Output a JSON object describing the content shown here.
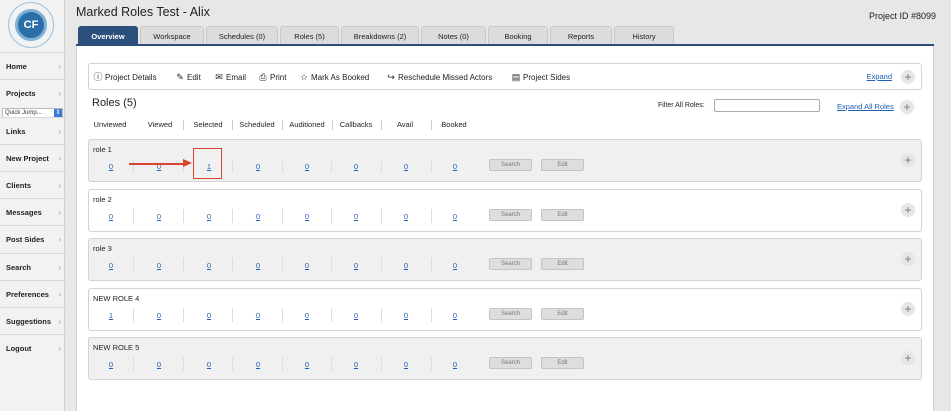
{
  "app": {
    "logo_text": "CF",
    "title": "Marked Roles Test - Alix",
    "project_id": "Project ID #8099"
  },
  "sidebar": {
    "items": [
      {
        "label": "Home"
      },
      {
        "label": "Projects"
      },
      {
        "label": "Links"
      },
      {
        "label": "New Project"
      },
      {
        "label": "Clients"
      },
      {
        "label": "Messages"
      },
      {
        "label": "Post Sides"
      },
      {
        "label": "Search"
      },
      {
        "label": "Preferences"
      },
      {
        "label": "Suggestions"
      },
      {
        "label": "Logout"
      }
    ],
    "quick_jump": "Quick Jump..."
  },
  "tabs": [
    {
      "label": "Overview",
      "active": true
    },
    {
      "label": "Workspace"
    },
    {
      "label": "Schedules (0)"
    },
    {
      "label": "Roles (5)"
    },
    {
      "label": "Breakdowns (2)"
    },
    {
      "label": "Notes (0)"
    },
    {
      "label": "Booking"
    },
    {
      "label": "Reports"
    },
    {
      "label": "History"
    }
  ],
  "actions": [
    {
      "label": "Project Details",
      "icon": "info-icon"
    },
    {
      "label": "Edit",
      "icon": "edit-icon"
    },
    {
      "label": "Email",
      "icon": "email-icon"
    },
    {
      "label": "Print",
      "icon": "print-icon"
    },
    {
      "label": "Mark As Booked",
      "icon": "star-icon"
    },
    {
      "label": "Reschedule Missed Actors",
      "icon": "share-icon"
    },
    {
      "label": "Project Sides",
      "icon": "document-icon"
    }
  ],
  "expand_label": "Expand",
  "roles_header": {
    "title": "Roles (5)",
    "filter_label": "Filter All Roles:",
    "filter_value": "",
    "expand_all": "Expand All Roles"
  },
  "columns": [
    "Unviewed",
    "Viewed",
    "Selected",
    "Scheduled",
    "Auditioned",
    "Callbacks",
    "Avail",
    "Booked"
  ],
  "role_buttons": {
    "search": "Search",
    "edit": "Edit"
  },
  "roles": [
    {
      "name": "role 1",
      "counts": [
        "0",
        "0",
        "1",
        "0",
        "0",
        "0",
        "0",
        "0"
      ]
    },
    {
      "name": "role 2",
      "counts": [
        "0",
        "0",
        "0",
        "0",
        "0",
        "0",
        "0",
        "0"
      ]
    },
    {
      "name": "role 3",
      "counts": [
        "0",
        "0",
        "0",
        "0",
        "0",
        "0",
        "0",
        "0"
      ]
    },
    {
      "name": "NEW ROLE 4",
      "counts": [
        "1",
        "0",
        "0",
        "0",
        "0",
        "0",
        "0",
        "0"
      ]
    },
    {
      "name": "NEW ROLE 5",
      "counts": [
        "0",
        "0",
        "0",
        "0",
        "0",
        "0",
        "0",
        "0"
      ]
    }
  ],
  "colors": {
    "accent": "#2c4f7c",
    "link": "#1f5fb4",
    "annotation": "#d6452f"
  }
}
